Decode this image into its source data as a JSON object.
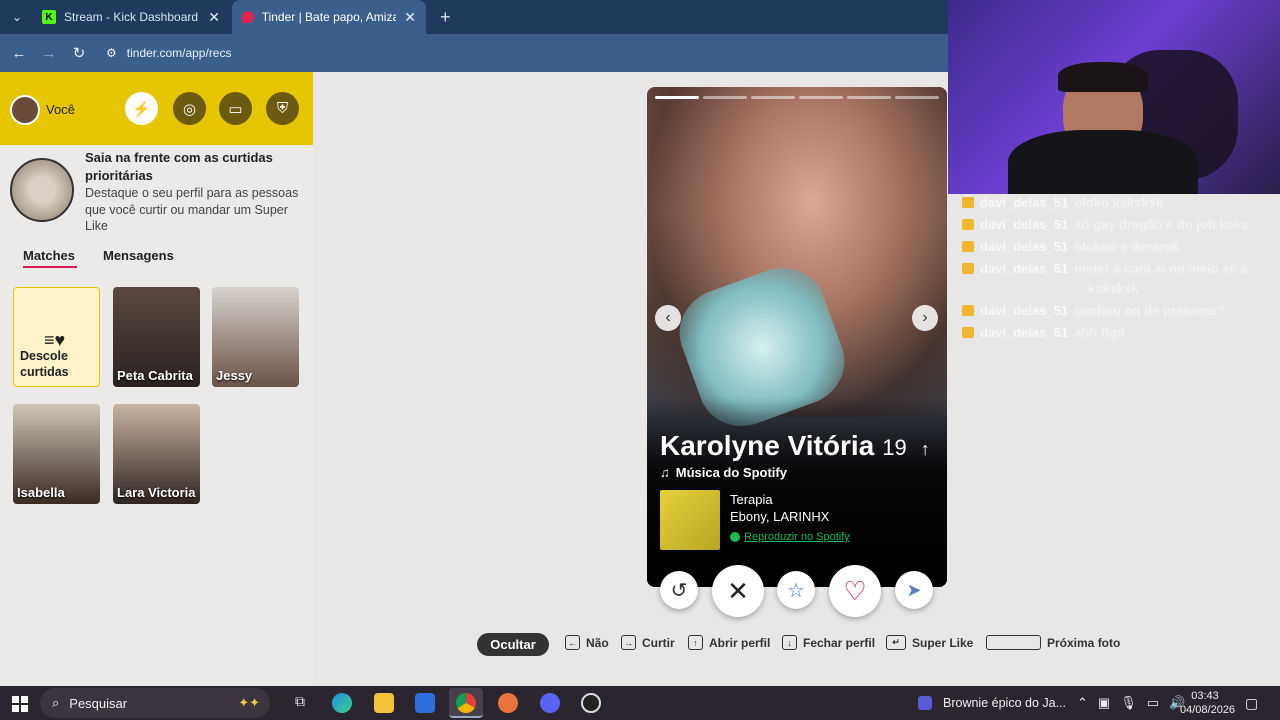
{
  "browser": {
    "tabs": [
      {
        "label": "Stream - Kick Dashboard"
      },
      {
        "label": "Tinder | Bate papo, Amizade, En"
      }
    ],
    "url": "tinder.com/app/recs"
  },
  "sidebar": {
    "user_label": "Você",
    "promo": {
      "title": "Saia na frente com as curtidas prioritárias",
      "text": "Destaque o seu perfil para as pessoas que você curtir ou mandar um Super Like"
    },
    "tabs": [
      "Matches",
      "Mensagens"
    ],
    "discover_card": "Descole curtidas",
    "matches": [
      {
        "name": "Peta Cabrita"
      },
      {
        "name": "Jessy"
      },
      {
        "name": "Isabella"
      },
      {
        "name": "Lara Victoria"
      }
    ]
  },
  "profile": {
    "name": "Karolyne Vitória",
    "age": "19",
    "spotify_label": "Música do Spotify",
    "song": "Terapia",
    "artist": "Ebony, LARINHX",
    "spotify_link": "Reproduzir no Spotify",
    "photo_count": 6
  },
  "hints": {
    "hide": "Ocultar",
    "no": "Não",
    "like": "Curtir",
    "open": "Abrir perfil",
    "close": "Fechar perfil",
    "super": "Super Like",
    "next": "Próxima foto"
  },
  "chat": [
    {
      "user": "davi_delas_51",
      "msg": "oloko ksksksk"
    },
    {
      "user": "davi_delas_51",
      "msg": "só gay dragão e do job ksks"
    },
    {
      "user": "davi_delas_51",
      "msg": "olokoo e dentrok"
    },
    {
      "user": "davi_delas_51",
      "msg": "meter a cara ai no meio se a"
    },
    {
      "user": "",
      "msg": "ksksksk"
    },
    {
      "user": "davi_delas_51",
      "msg": "ganhou oq de presente?"
    },
    {
      "user": "davi_delas_51",
      "msg": "ahh tlgd"
    }
  ],
  "taskbar": {
    "search": "Pesquisar",
    "media": "Brownie épico do Ja...",
    "time": "03:43",
    "date": "04/08/2026"
  },
  "colors": {
    "tinder_yellow": "#e6c600",
    "like": "#c8102e",
    "spotify": "#1db954"
  }
}
